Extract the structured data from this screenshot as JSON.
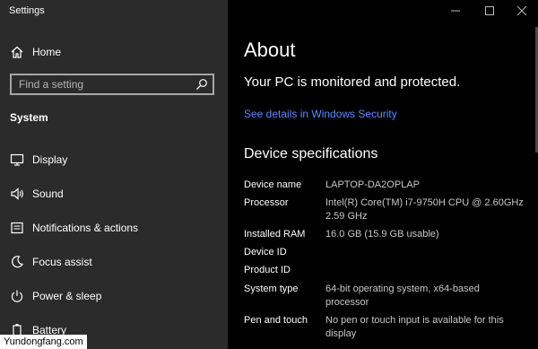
{
  "window": {
    "title": "Settings",
    "controls": {
      "minimize": "minimize-icon",
      "maximize": "maximize-icon",
      "close": "close-icon"
    }
  },
  "sidebar": {
    "home_label": "Home",
    "search": {
      "placeholder": "Find a setting",
      "value": ""
    },
    "section": "System",
    "items": [
      {
        "label": "Display",
        "icon": "display-icon"
      },
      {
        "label": "Sound",
        "icon": "sound-icon"
      },
      {
        "label": "Notifications & actions",
        "icon": "notifications-icon"
      },
      {
        "label": "Focus assist",
        "icon": "focus-assist-icon"
      },
      {
        "label": "Power & sleep",
        "icon": "power-icon"
      },
      {
        "label": "Battery",
        "icon": "battery-icon"
      }
    ]
  },
  "main": {
    "title": "About",
    "protection_status": "Your PC is monitored and protected.",
    "security_link": "See details in Windows Security",
    "device_specs_heading": "Device specifications",
    "specs": [
      {
        "label": "Device name",
        "value": "LAPTOP-DA2OPLAP"
      },
      {
        "label": "Processor",
        "value": "Intel(R) Core(TM) i7-9750H CPU @ 2.60GHz 2.59 GHz"
      },
      {
        "label": "Installed RAM",
        "value": "16.0 GB (15.9 GB usable)"
      },
      {
        "label": "Device ID",
        "value": ""
      },
      {
        "label": "Product ID",
        "value": ""
      },
      {
        "label": "System type",
        "value": "64-bit operating system, x64-based processor"
      },
      {
        "label": "Pen and touch",
        "value": "No pen or touch input is available for this display"
      }
    ]
  },
  "watermark": "Yundongfang.com",
  "colors": {
    "sidebar_bg": "#2b2b2b",
    "main_bg": "#000000",
    "link": "#5b8cff",
    "search_border": "#a6a6a6"
  }
}
